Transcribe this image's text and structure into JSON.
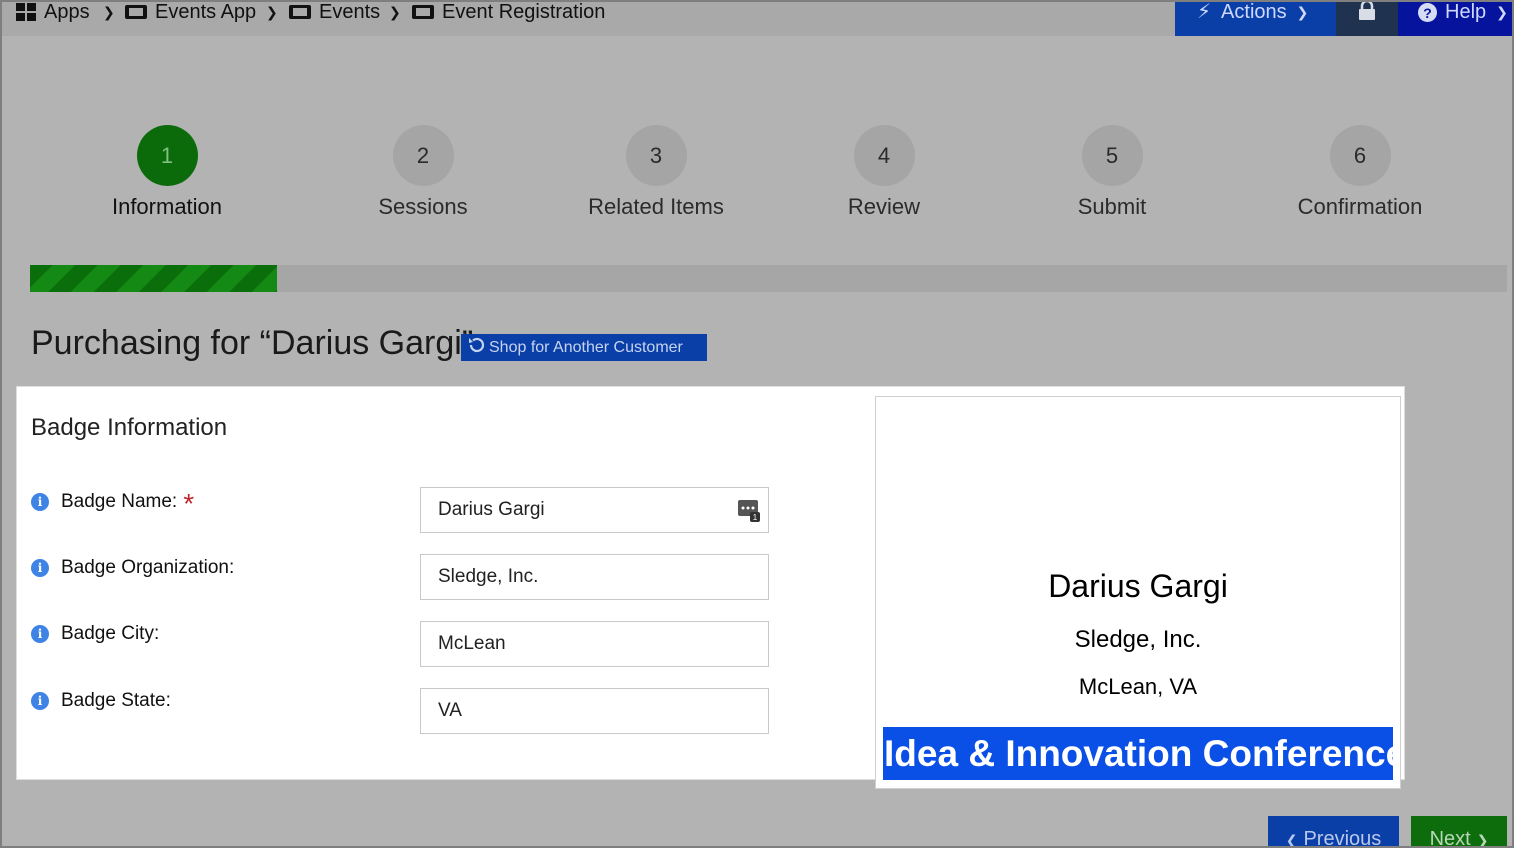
{
  "breadcrumb": [
    {
      "label": "Apps",
      "icon": "apps-grid-icon"
    },
    {
      "label": "Events App",
      "icon": "ticket-icon"
    },
    {
      "label": "Events",
      "icon": "ticket-icon"
    },
    {
      "label": "Event Registration",
      "icon": "ticket-icon"
    }
  ],
  "topbar": {
    "actions_label": "Actions",
    "help_label": "Help",
    "colors": {
      "actions_bg": "#0b3fa8",
      "lock_bg": "#1f3351",
      "help_bg": "#06139c"
    }
  },
  "steps": [
    {
      "number": "1",
      "label": "Information",
      "active": true
    },
    {
      "number": "2",
      "label": "Sessions",
      "active": false
    },
    {
      "number": "3",
      "label": "Related Items",
      "active": false
    },
    {
      "number": "4",
      "label": "Review",
      "active": false
    },
    {
      "number": "5",
      "label": "Submit",
      "active": false
    },
    {
      "number": "6",
      "label": "Confirmation",
      "active": false
    }
  ],
  "progress": {
    "fraction": 0.167,
    "color": "#0a6e0a"
  },
  "purchase": {
    "heading": "Purchasing for “Darius Gargi”",
    "shop_another_label": "Shop for Another Customer"
  },
  "badge_form": {
    "title": "Badge Information",
    "fields": [
      {
        "label": "Badge Name:",
        "value": "Darius Gargi",
        "required": true
      },
      {
        "label": "Badge Organization:",
        "value": "Sledge, Inc.",
        "required": false
      },
      {
        "label": "Badge City:",
        "value": "McLean",
        "required": false
      },
      {
        "label": "Badge State:",
        "value": "VA",
        "required": false
      }
    ]
  },
  "badge_preview": {
    "name": "Darius Gargi",
    "organization": "Sledge, Inc.",
    "location": "McLean, VA",
    "banner": "Idea & Innovation Conference",
    "banner_color": "#0a50e6"
  },
  "nav": {
    "previous_label": "Previous",
    "next_label": "Next"
  }
}
